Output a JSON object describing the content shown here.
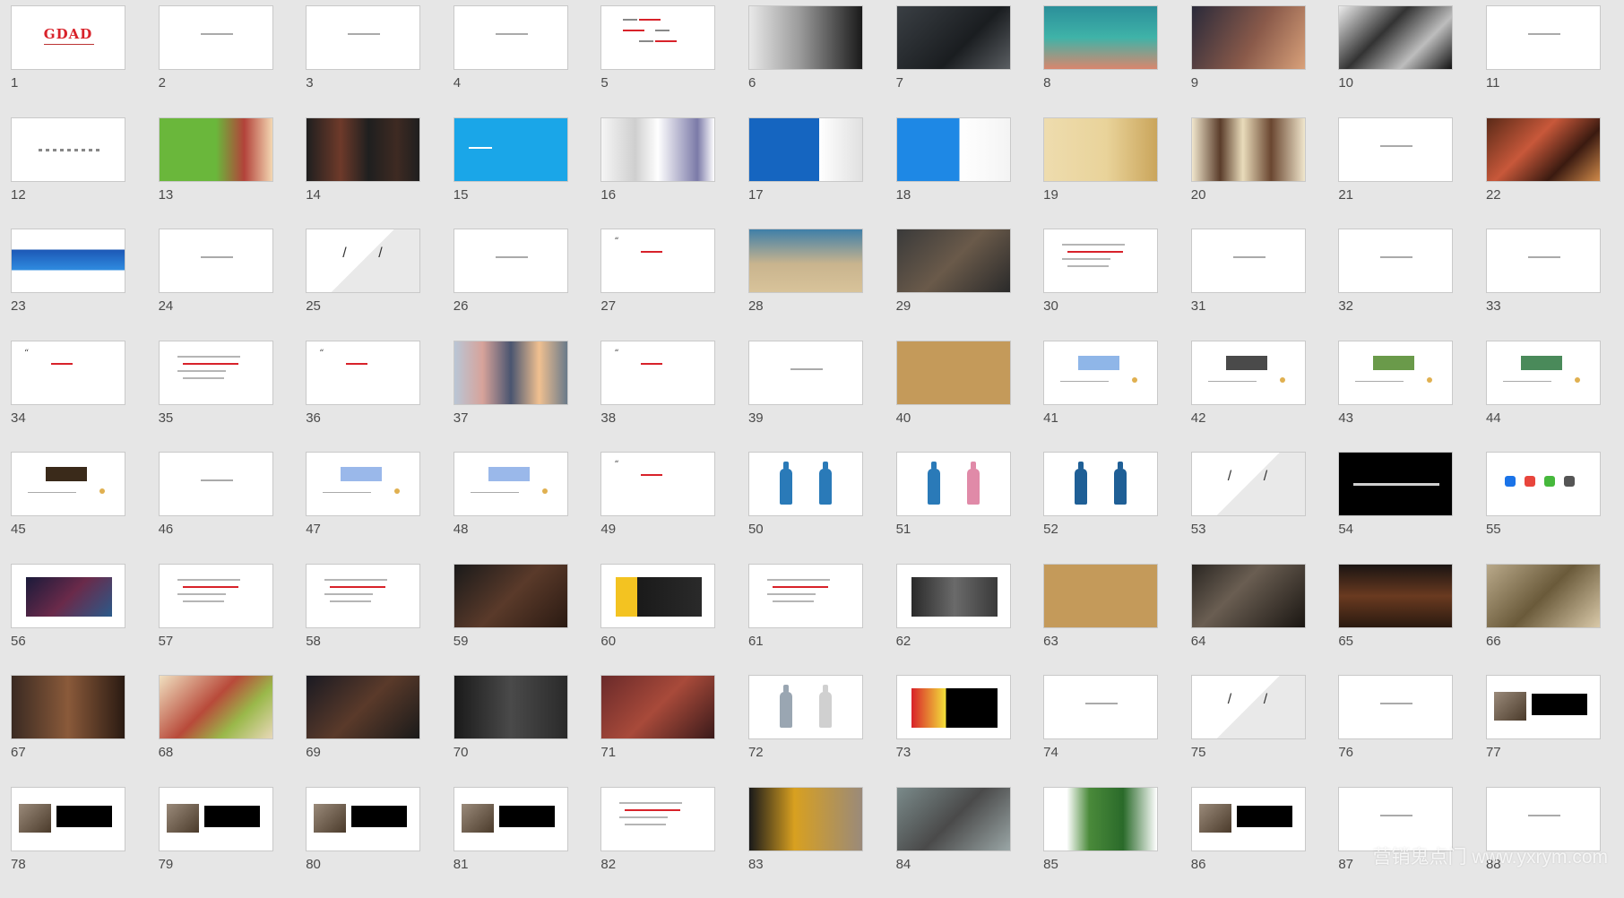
{
  "watermark": "营销鬼点门 www.yxrym.com",
  "slides": [
    {
      "n": "1",
      "bg": "#ffffff",
      "kind": "logo",
      "text": "GDAD",
      "accent": "#d8222a"
    },
    {
      "n": "2",
      "bg": "#ffffff",
      "kind": "smalltext"
    },
    {
      "n": "3",
      "bg": "#ffffff",
      "kind": "smalltext"
    },
    {
      "n": "4",
      "bg": "#ffffff",
      "kind": "smalltext"
    },
    {
      "n": "5",
      "bg": "#ffffff",
      "kind": "mindmap"
    },
    {
      "n": "6",
      "bg": "linear-gradient(90deg,#e8e8e8 0%,#9a9a9a 45%,#1a1a1a 100%)",
      "kind": "photo"
    },
    {
      "n": "7",
      "bg": "linear-gradient(135deg,#3a3f44 0%,#1a1d20 60%,#5a5e62 100%)",
      "kind": "photo"
    },
    {
      "n": "8",
      "bg": "linear-gradient(180deg,#2b8f9a 0%,#3fb3a8 50%,#d9866d 100%)",
      "kind": "photo"
    },
    {
      "n": "9",
      "bg": "linear-gradient(120deg,#2a2a3a 0%,#8a5a4a 55%,#d9a17a 100%)",
      "kind": "photo"
    },
    {
      "n": "10",
      "bg": "linear-gradient(135deg,#ececec 0%,#333333 40%,#bdbdbd 70%,#111111 100%)",
      "kind": "photo"
    },
    {
      "n": "11",
      "bg": "#ffffff",
      "kind": "smalltext"
    },
    {
      "n": "12",
      "bg": "#ffffff",
      "kind": "dots"
    },
    {
      "n": "13",
      "bg": "linear-gradient(90deg,#6ab73b 0%,#6ab73b 50%,#b3423a 75%,#f3d7b2 100%)",
      "kind": "photo"
    },
    {
      "n": "14",
      "bg": "linear-gradient(90deg,#1f1f1f 0%,#6e3a2a 30%,#1f1f1f 55%,#3e2a22 80%,#1f1f1f 100%)",
      "kind": "photo"
    },
    {
      "n": "15",
      "bg": "#1aa6e8",
      "kind": "brand"
    },
    {
      "n": "16",
      "bg": "linear-gradient(90deg,#f5f5f5 0%,#cfcfcf 30%,#ffffff 50%,#7b7aa8 85%,#ffffff 100%)",
      "kind": "photo"
    },
    {
      "n": "17",
      "bg": "linear-gradient(90deg,#1565c0 0%,#1565c0 62%,#ffffff 62%,#e0e0e0 100%)",
      "kind": "photo"
    },
    {
      "n": "18",
      "bg": "linear-gradient(90deg,#1e88e5 0%,#1e88e5 55%,#ffffff 55%,#f4f4f4 100%)",
      "kind": "photo"
    },
    {
      "n": "19",
      "bg": "linear-gradient(90deg,#eedcae 0%,#e9d39a 55%,#caa55b 100%)",
      "kind": "photo"
    },
    {
      "n": "20",
      "bg": "linear-gradient(90deg,#f0e6cc 0%,#5a3c2a 25%,#e9dcbb 45%,#6a4630 70%,#f0e6cc 100%)",
      "kind": "photo"
    },
    {
      "n": "21",
      "bg": "#ffffff",
      "kind": "smalltext"
    },
    {
      "n": "22",
      "bg": "linear-gradient(135deg,#5a2a18 0%,#c8583a 40%,#3a1a10 70%,#d08a4a 100%)",
      "kind": "photo"
    },
    {
      "n": "23",
      "bg": "linear-gradient(180deg,#ffffff 0%,#ffffff 32%,#1c57b5 32%,#2f8ce0 65%,#ffffff 65%)",
      "kind": "photo"
    },
    {
      "n": "24",
      "bg": "#ffffff",
      "kind": "smalltext"
    },
    {
      "n": "25",
      "bg": "#ffffff",
      "kind": "slashes"
    },
    {
      "n": "26",
      "bg": "#ffffff",
      "kind": "smalltext"
    },
    {
      "n": "27",
      "bg": "#ffffff",
      "kind": "quote"
    },
    {
      "n": "28",
      "bg": "linear-gradient(180deg,#3f7fa8 0%,#c9b48e 55%,#d8c39a 100%)",
      "kind": "photo"
    },
    {
      "n": "29",
      "bg": "linear-gradient(135deg,#3a3a3a 0%,#6a5a4a 50%,#2a2a2a 100%)",
      "kind": "photo"
    },
    {
      "n": "30",
      "bg": "#ffffff",
      "kind": "lines"
    },
    {
      "n": "31",
      "bg": "#ffffff",
      "kind": "smalltext"
    },
    {
      "n": "32",
      "bg": "#ffffff",
      "kind": "smalltext"
    },
    {
      "n": "33",
      "bg": "#ffffff",
      "kind": "smalltext"
    },
    {
      "n": "34",
      "bg": "#ffffff",
      "kind": "quote"
    },
    {
      "n": "35",
      "bg": "#ffffff",
      "kind": "lines"
    },
    {
      "n": "36",
      "bg": "#ffffff",
      "kind": "quote"
    },
    {
      "n": "37",
      "bg": "linear-gradient(90deg,#b9c6d6 0%,#d7a39a 25%,#4a5570 50%,#f0c090 75%,#6a7a8a 100%)",
      "kind": "photo"
    },
    {
      "n": "38",
      "bg": "#ffffff",
      "kind": "quote"
    },
    {
      "n": "39",
      "bg": "#ffffff",
      "kind": "smalltext"
    },
    {
      "n": "40",
      "bg": "#c49a5a",
      "kind": "plain"
    },
    {
      "n": "41",
      "bg": "#ffffff",
      "kind": "banner",
      "accent": "#8fb6e8"
    },
    {
      "n": "42",
      "bg": "#ffffff",
      "kind": "banner",
      "accent": "#4a4a4a"
    },
    {
      "n": "43",
      "bg": "#ffffff",
      "kind": "banner",
      "accent": "#6a9a4a"
    },
    {
      "n": "44",
      "bg": "#ffffff",
      "kind": "banner",
      "accent": "#4a8a5a"
    },
    {
      "n": "45",
      "bg": "#ffffff",
      "kind": "banner",
      "accent": "#3a2a1a"
    },
    {
      "n": "46",
      "bg": "#ffffff",
      "kind": "smalltext"
    },
    {
      "n": "47",
      "bg": "#ffffff",
      "kind": "banner",
      "accent": "#9ab8ea"
    },
    {
      "n": "48",
      "bg": "#ffffff",
      "kind": "banner",
      "accent": "#9ab8ea"
    },
    {
      "n": "49",
      "bg": "#ffffff",
      "kind": "quote"
    },
    {
      "n": "50",
      "bg": "#ffffff",
      "kind": "bottles",
      "colors": [
        "#2a7ab8",
        "#2a7ab8"
      ]
    },
    {
      "n": "51",
      "bg": "#ffffff",
      "kind": "bottles",
      "colors": [
        "#2a7ab8",
        "#e08aa8"
      ]
    },
    {
      "n": "52",
      "bg": "#ffffff",
      "kind": "bottles",
      "colors": [
        "#1f5f96",
        "#1f5f96"
      ]
    },
    {
      "n": "53",
      "bg": "#ffffff",
      "kind": "slashes"
    },
    {
      "n": "54",
      "bg": "#000000",
      "kind": "darktext"
    },
    {
      "n": "55",
      "bg": "#ffffff",
      "kind": "icons"
    },
    {
      "n": "56",
      "bg": "#ffffff",
      "kind": "inset",
      "accent": "linear-gradient(135deg,#1a1a3a 0%,#6a2a4a 50%,#2a5a8a 100%)"
    },
    {
      "n": "57",
      "bg": "#ffffff",
      "kind": "lines"
    },
    {
      "n": "58",
      "bg": "#ffffff",
      "kind": "lines"
    },
    {
      "n": "59",
      "bg": "linear-gradient(135deg,#1a1a1a 0%,#5a3a2a 50%,#2a1a12 100%)",
      "kind": "photo"
    },
    {
      "n": "60",
      "bg": "#ffffff",
      "kind": "inset",
      "accent": "linear-gradient(90deg,#f3c321 0%,#f3c321 25%,#1a1a1a 25%,#2a2a2a 100%)"
    },
    {
      "n": "61",
      "bg": "#ffffff",
      "kind": "lines"
    },
    {
      "n": "62",
      "bg": "#ffffff",
      "kind": "inset",
      "accent": "linear-gradient(90deg,#2a2a2a 0%,#6a6a6a 50%,#3a3a3a 100%)"
    },
    {
      "n": "63",
      "bg": "#c49a5a",
      "kind": "plain"
    },
    {
      "n": "64",
      "bg": "linear-gradient(135deg,#2a2622 0%,#6a5e52 40%,#1a1612 100%)",
      "kind": "photo"
    },
    {
      "n": "65",
      "bg": "linear-gradient(180deg,#1a1412 0%,#6a3a20 50%,#2a1a10 100%)",
      "kind": "photo"
    },
    {
      "n": "66",
      "bg": "linear-gradient(135deg,#b9a98a 0%,#6a5a3a 50%,#d9c9a9 100%)",
      "kind": "photo"
    },
    {
      "n": "67",
      "bg": "linear-gradient(90deg,#3a2a22 0%,#8a5a3a 50%,#2a1a12 100%)",
      "kind": "photo"
    },
    {
      "n": "68",
      "bg": "linear-gradient(135deg,#f0e0c0 0%,#b84a3a 45%,#9ab84a 70%,#e8d8b8 100%)",
      "kind": "photo"
    },
    {
      "n": "69",
      "bg": "linear-gradient(135deg,#1a1a22 0%,#5a3a2a 50%,#1a1a1a 100%)",
      "kind": "photo"
    },
    {
      "n": "70",
      "bg": "linear-gradient(90deg,#1a1a1a 0%,#4a4a4a 50%,#2a2a2a 100%)",
      "kind": "photo"
    },
    {
      "n": "71",
      "bg": "linear-gradient(135deg,#6a2a2a 0%,#a84a3a 50%,#3a1a1a 100%)",
      "kind": "photo"
    },
    {
      "n": "72",
      "bg": "#ffffff",
      "kind": "bottles",
      "colors": [
        "#9aa6b2",
        "#d0d0d0"
      ]
    },
    {
      "n": "73",
      "bg": "#ffffff",
      "kind": "inset",
      "accent": "linear-gradient(90deg,#d8222a 0%,#f3e13a 40%,#000000 40%,#000000 100%)"
    },
    {
      "n": "74",
      "bg": "#ffffff",
      "kind": "smalltext"
    },
    {
      "n": "75",
      "bg": "#ffffff",
      "kind": "slashes"
    },
    {
      "n": "76",
      "bg": "#ffffff",
      "kind": "smalltext"
    },
    {
      "n": "77",
      "bg": "#ffffff",
      "kind": "speech"
    },
    {
      "n": "78",
      "bg": "#ffffff",
      "kind": "speech"
    },
    {
      "n": "79",
      "bg": "#ffffff",
      "kind": "speech"
    },
    {
      "n": "80",
      "bg": "#ffffff",
      "kind": "speech"
    },
    {
      "n": "81",
      "bg": "#ffffff",
      "kind": "speech"
    },
    {
      "n": "82",
      "bg": "#ffffff",
      "kind": "lines"
    },
    {
      "n": "83",
      "bg": "linear-gradient(90deg,#1a1a1a 0%,#d8a020 40%,#9a8a7a 100%)",
      "kind": "photo"
    },
    {
      "n": "84",
      "bg": "linear-gradient(135deg,#7a8a8a 0%,#4a4a4a 50%,#9aa6a6 100%)",
      "kind": "photo"
    },
    {
      "n": "85",
      "bg": "linear-gradient(90deg,#ffffff 0%,#ffffff 20%,#4a8a3a 40%,#2a6a2a 70%,#ffffff 100%)",
      "kind": "photo"
    },
    {
      "n": "86",
      "bg": "#ffffff",
      "kind": "speech"
    },
    {
      "n": "87",
      "bg": "#ffffff",
      "kind": "smalltext"
    },
    {
      "n": "88",
      "bg": "#ffffff",
      "kind": "smalltext"
    }
  ]
}
